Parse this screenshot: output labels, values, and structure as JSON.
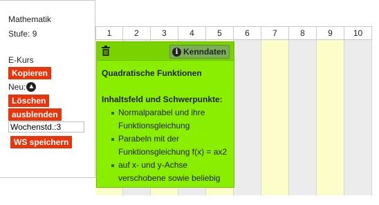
{
  "left": {
    "subject": "Mathematik",
    "stufe": "Stufe: 9",
    "kurs": "E-Kurs",
    "copy_label": "Kopieren",
    "neu_label": "Neu:",
    "delete_label": "Löschen",
    "hide_label": "ausblenden",
    "ws_label": "Wochenstd.:",
    "ws_value": "3",
    "save_label": "WS speichern"
  },
  "columns": [
    "1",
    "2",
    "3",
    "4",
    "5",
    "6",
    "7",
    "8",
    "9",
    "10"
  ],
  "card": {
    "info_label": "Kenndaten",
    "title": "Quadratische Funktionen",
    "section": "Inhaltsfeld und Schwerpunkte:",
    "items": [
      "Normalparabel und ihre Funktionsgleichung",
      "Parabeln mit der Funktionsgleichung f(x) = ax2",
      "auf x- und y-Achse verschobene sowie beliebig"
    ]
  },
  "colors": {
    "button_red": "#e8350c",
    "card_green": "#8aee00",
    "col_yellow": "#fdfdc9",
    "col_gray": "#ececec"
  }
}
